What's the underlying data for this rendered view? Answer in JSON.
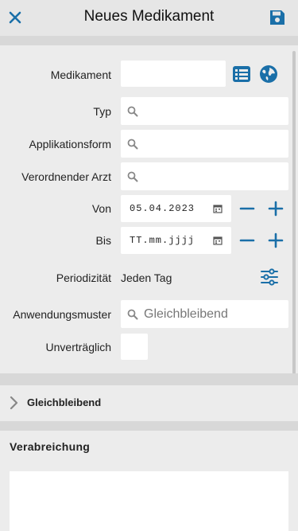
{
  "header": {
    "title": "Neues Medikament"
  },
  "form": {
    "medikament_label": "Medikament",
    "typ_label": "Typ",
    "applikationsform_label": "Applikationsform",
    "arzt_label": "Verordnender Arzt",
    "von_label": "Von",
    "von_value": "05.04.2023",
    "bis_label": "Bis",
    "bis_value": "TT.mm.jjjj",
    "periodizitaet_label": "Periodizität",
    "periodizitaet_value": "Jeden Tag",
    "anwendungsmuster_label": "Anwendungsmuster",
    "anwendungsmuster_placeholder": "Gleichbleibend",
    "unvertraeglich_label": "Unverträglich"
  },
  "section": {
    "label": "Gleichbleibend"
  },
  "verabreichung": {
    "heading": "Verabreichung"
  },
  "colors": {
    "accent": "#1a6fa8",
    "background": "#ececec",
    "divider": "#d8d8d8"
  },
  "icons": [
    "close-icon",
    "save-icon",
    "list-icon",
    "globe-icon",
    "search-icon",
    "calendar-icon",
    "minus-icon",
    "plus-icon",
    "sliders-icon",
    "chevron-right-icon"
  ]
}
